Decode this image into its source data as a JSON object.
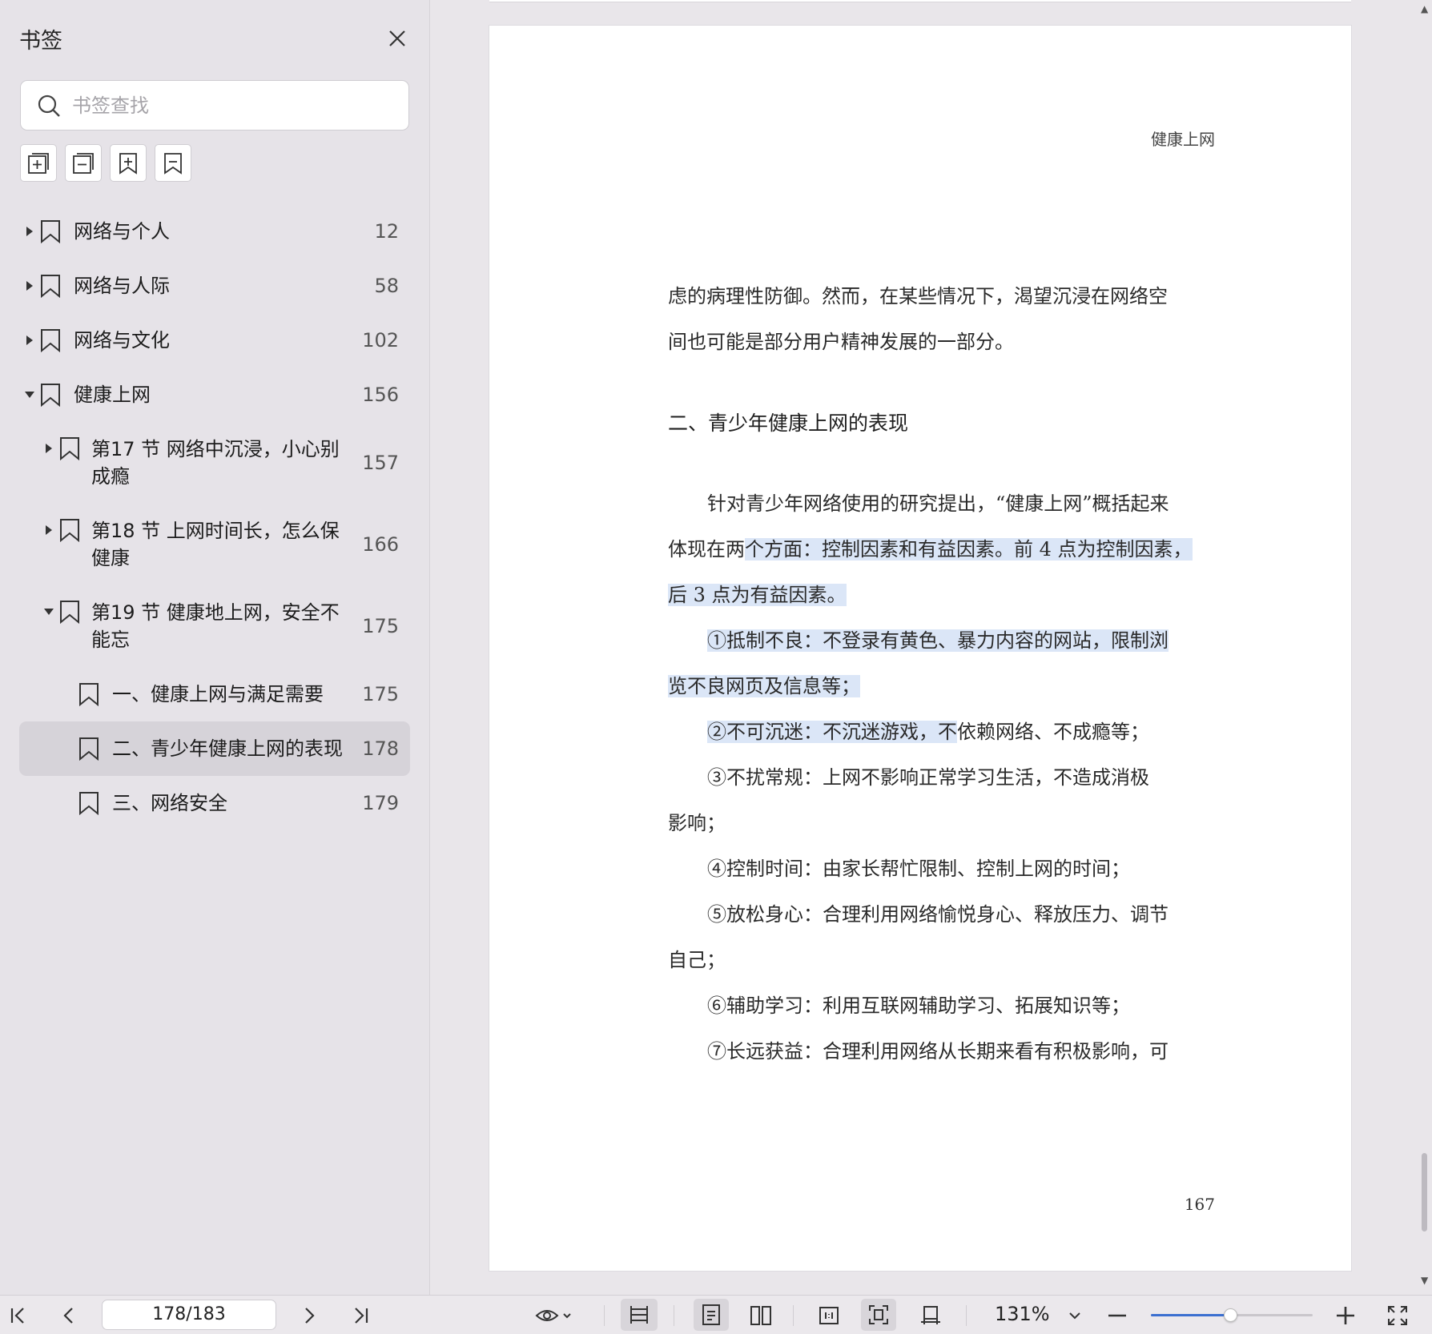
{
  "sidebar": {
    "title": "书签",
    "search_placeholder": "书签查找",
    "toolbar": [
      "expand-all-icon",
      "collapse-all-icon",
      "add-bookmark-icon",
      "remove-bookmark-icon"
    ],
    "items": [
      {
        "label": "网络与个人",
        "page": "12",
        "level": 0,
        "caret": "right"
      },
      {
        "label": "网络与人际",
        "page": "58",
        "level": 0,
        "caret": "right"
      },
      {
        "label": "网络与文化",
        "page": "102",
        "level": 0,
        "caret": "right"
      },
      {
        "label": "健康上网",
        "page": "156",
        "level": 0,
        "caret": "down"
      },
      {
        "label": "第17 节 网络中沉浸，小心别成瘾",
        "line1": "第17 节 网络中沉浸，小心别",
        "line2": "成瘾",
        "page": "157",
        "level": 1,
        "caret": "right"
      },
      {
        "label": "第18 节 上网时间长，怎么保健康",
        "line1": "第18 节 上网时间长，怎么保",
        "line2": "健康",
        "page": "166",
        "level": 1,
        "caret": "right"
      },
      {
        "label": "第19 节 健康地上网，安全不能忘",
        "line1": "第19 节 健康地上网，安全不",
        "line2": "能忘",
        "page": "175",
        "level": 1,
        "caret": "down"
      },
      {
        "label": "一、健康上网与满足需要",
        "page": "175",
        "level": 2,
        "caret": "none"
      },
      {
        "label": "二、青少年健康上网的表现",
        "page": "178",
        "level": 2,
        "caret": "none",
        "selected": true
      },
      {
        "label": "三、网络安全",
        "page": "179",
        "level": 2,
        "caret": "none"
      }
    ]
  },
  "document": {
    "running_head": "健康上网",
    "para1_line1": "虑的病理性防御。然而，在某些情况下，渴望沉浸在网络空",
    "para1_line2": "间也可能是部分用户精神发展的一部分。",
    "section_heading": "二、青少年健康上网的表现",
    "para2_line1": "针对青少年网络使用的研究提出，“健康上网”概括起来",
    "para2_line2_a": "体现在两",
    "para2_line2_b": "个方面：控制因素和有益因素。前 4 点为控制因素，",
    "para2_line3": "后 3 点为有益因素。",
    "item1_line1": "①抵制不良：不登录有黄色、暴力内容的网站，限制浏",
    "item1_line2": "览不良网页及信息等；",
    "item2_a": "②不可沉迷：不沉迷游戏，不",
    "item2_b": "依赖网络、不成瘾等；",
    "item3_line1": "③不扰常规：上网不影响正常学习生活，不造成消极",
    "item3_line2": "影响；",
    "item4": "④控制时间：由家长帮忙限制、控制上网的时间；",
    "item5_line1": "⑤放松身心：合理利用网络愉悦身心、释放压力、调节",
    "item5_line2": "自己；",
    "item6": "⑥辅助学习：利用互联网辅助学习、拓展知识等；",
    "item7": "⑦长远获益：合理利用网络从长期来看有积极影响，可",
    "page_number": "167"
  },
  "bottom_bar": {
    "page_indicator": "178/183",
    "zoom_label": "131%",
    "zoom_slider_fraction": 0.49,
    "accent_color": "#3b6fd0"
  }
}
